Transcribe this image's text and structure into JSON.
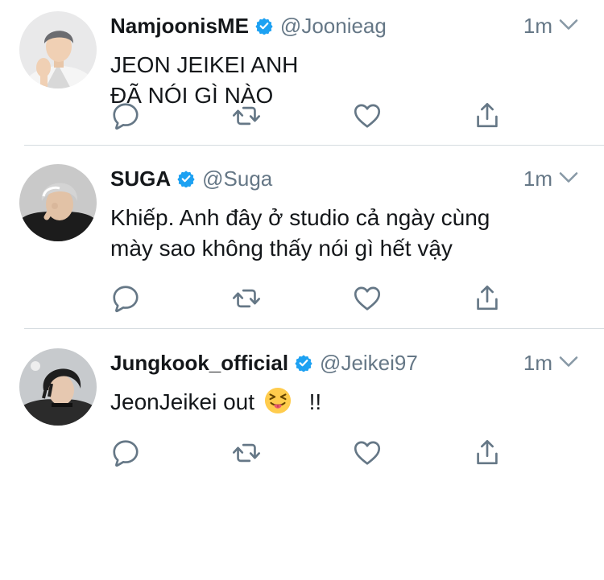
{
  "tweets": [
    {
      "name": "NamjoonisME",
      "handle": "@Joonieag",
      "time": "1m",
      "text": [
        "JEON JEIKEI ANH",
        "ĐÃ NÓI GÌ NÀO"
      ],
      "avatar_icon": "avatar-photo-icon"
    },
    {
      "name": "SUGA",
      "handle": "@Suga",
      "time": "1m",
      "text": [
        "Khiếp. Anh đây ở studio cả ngày cùng",
        "mày sao không thấy nói gì hết vậy"
      ],
      "avatar_icon": "avatar-photo-icon"
    },
    {
      "name": "Jungkook_official",
      "handle": "@Jeikei97",
      "time": "1m",
      "text_before_emoji": "JeonJeikei out",
      "text_after_emoji": "!!",
      "emoji_icon": "squinting-tongue-face-icon",
      "avatar_icon": "avatar-photo-icon"
    }
  ],
  "icons": {
    "verified": "verified-badge-icon",
    "reply": "reply-icon",
    "retweet": "retweet-icon",
    "like": "heart-icon",
    "share": "share-icon",
    "menu": "chevron-down-icon"
  },
  "colors": {
    "name": "#14171a",
    "secondary": "#657786",
    "verified": "#1da1f2",
    "action_icon": "#657786",
    "divider": "#d5dbe0"
  }
}
